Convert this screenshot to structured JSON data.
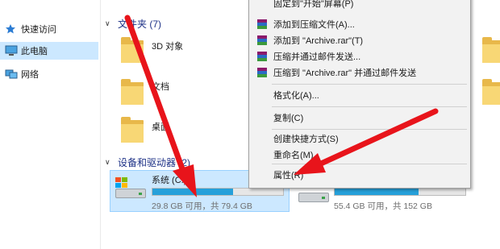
{
  "nav": {
    "quick_access": "快速访问",
    "this_pc": "此电脑",
    "network": "网络"
  },
  "sections": {
    "folders": "文件夹 (7)",
    "devices": "设备和驱动器 (2)"
  },
  "folders": [
    {
      "label": "3D 对象"
    },
    {
      "label": "文档"
    },
    {
      "label": "桌面"
    }
  ],
  "drives": [
    {
      "name": "系统 (C:)",
      "free_text": "29.8 GB 可用，共 79.4 GB",
      "used_fraction": 0.62
    },
    {
      "name": "",
      "free_text": "55.4 GB 可用，共 152 GB",
      "used_fraction": 0.64
    }
  ],
  "menu": {
    "pin_start": "固定到\"开始\"屏幕(P)",
    "add_archive": "添加到压缩文件(A)...",
    "add_rar": "添加到 \"Archive.rar\"(T)",
    "compress_email": "压缩并通过邮件发送...",
    "compress_rar_email": "压缩到 \"Archive.rar\" 并通过邮件发送",
    "format": "格式化(A)...",
    "copy": "复制(C)",
    "create_shortcut": "创建快捷方式(S)",
    "rename": "重命名(M)",
    "properties": "属性(R)"
  },
  "colors": {
    "selection": "#cce8ff",
    "drive_fill": "#26a0da",
    "arrow": "#e8141b",
    "section_text": "#1e3287"
  }
}
